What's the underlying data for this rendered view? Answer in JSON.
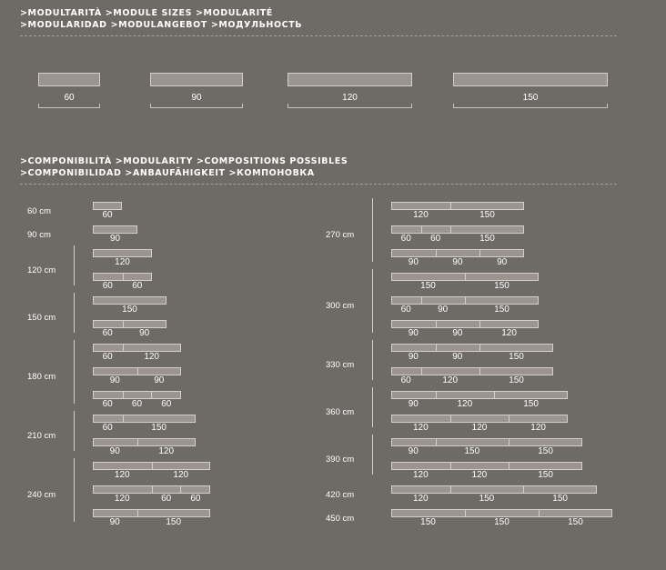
{
  "header_sizes": [
    ">MODULTARITÀ >MODULE SIZES >MODULARITÉ",
    ">MODULARIDAD >MODULANGEBOT >МОДУЛЬНОСТЬ"
  ],
  "header_compositions": [
    ">COMPONIBILITÀ >MODULARITY >COMPOSITIONS POSSIBLES",
    ">COMPONIBILIDAD >ANBAUFÄHIGKEIT >КОМПОНОВКА"
  ],
  "modules": [
    "60",
    "90",
    "120",
    "150"
  ],
  "cm_unit": "cm",
  "compositions_left": [
    {
      "total": "60",
      "rows": [
        [
          "60"
        ]
      ]
    },
    {
      "total": "90",
      "rows": [
        [
          "90"
        ]
      ]
    },
    {
      "total": "120",
      "rows": [
        [
          "120"
        ],
        [
          "60",
          "60"
        ]
      ]
    },
    {
      "total": "150",
      "rows": [
        [
          "150"
        ],
        [
          "60",
          "90"
        ]
      ]
    },
    {
      "total": "180",
      "rows": [
        [
          "60",
          "120"
        ],
        [
          "90",
          "90"
        ],
        [
          "60",
          "60",
          "60"
        ]
      ]
    },
    {
      "total": "210",
      "rows": [
        [
          "60",
          "150"
        ],
        [
          "90",
          "120"
        ]
      ]
    },
    {
      "total": "240",
      "rows": [
        [
          "120",
          "120"
        ],
        [
          "120",
          "60",
          "60"
        ],
        [
          "90",
          "150"
        ]
      ]
    }
  ],
  "compositions_right": [
    {
      "total": "270",
      "rows": [
        [
          "120",
          "150"
        ],
        [
          "60",
          "60",
          "150"
        ],
        [
          "90",
          "90",
          "90"
        ]
      ]
    },
    {
      "total": "300",
      "rows": [
        [
          "150",
          "150"
        ],
        [
          "60",
          "90",
          "150"
        ],
        [
          "90",
          "90",
          "120"
        ]
      ]
    },
    {
      "total": "330",
      "rows": [
        [
          "90",
          "90",
          "150"
        ],
        [
          "60",
          "120",
          "150"
        ]
      ]
    },
    {
      "total": "360",
      "rows": [
        [
          "90",
          "120",
          "150"
        ],
        [
          "120",
          "120",
          "120"
        ]
      ]
    },
    {
      "total": "390",
      "rows": [
        [
          "90",
          "150",
          "150"
        ],
        [
          "120",
          "120",
          "150"
        ]
      ]
    },
    {
      "total": "420",
      "rows": [
        [
          "120",
          "150",
          "150"
        ]
      ]
    },
    {
      "total": "450",
      "rows": [
        [
          "150",
          "150",
          "150"
        ]
      ]
    }
  ]
}
